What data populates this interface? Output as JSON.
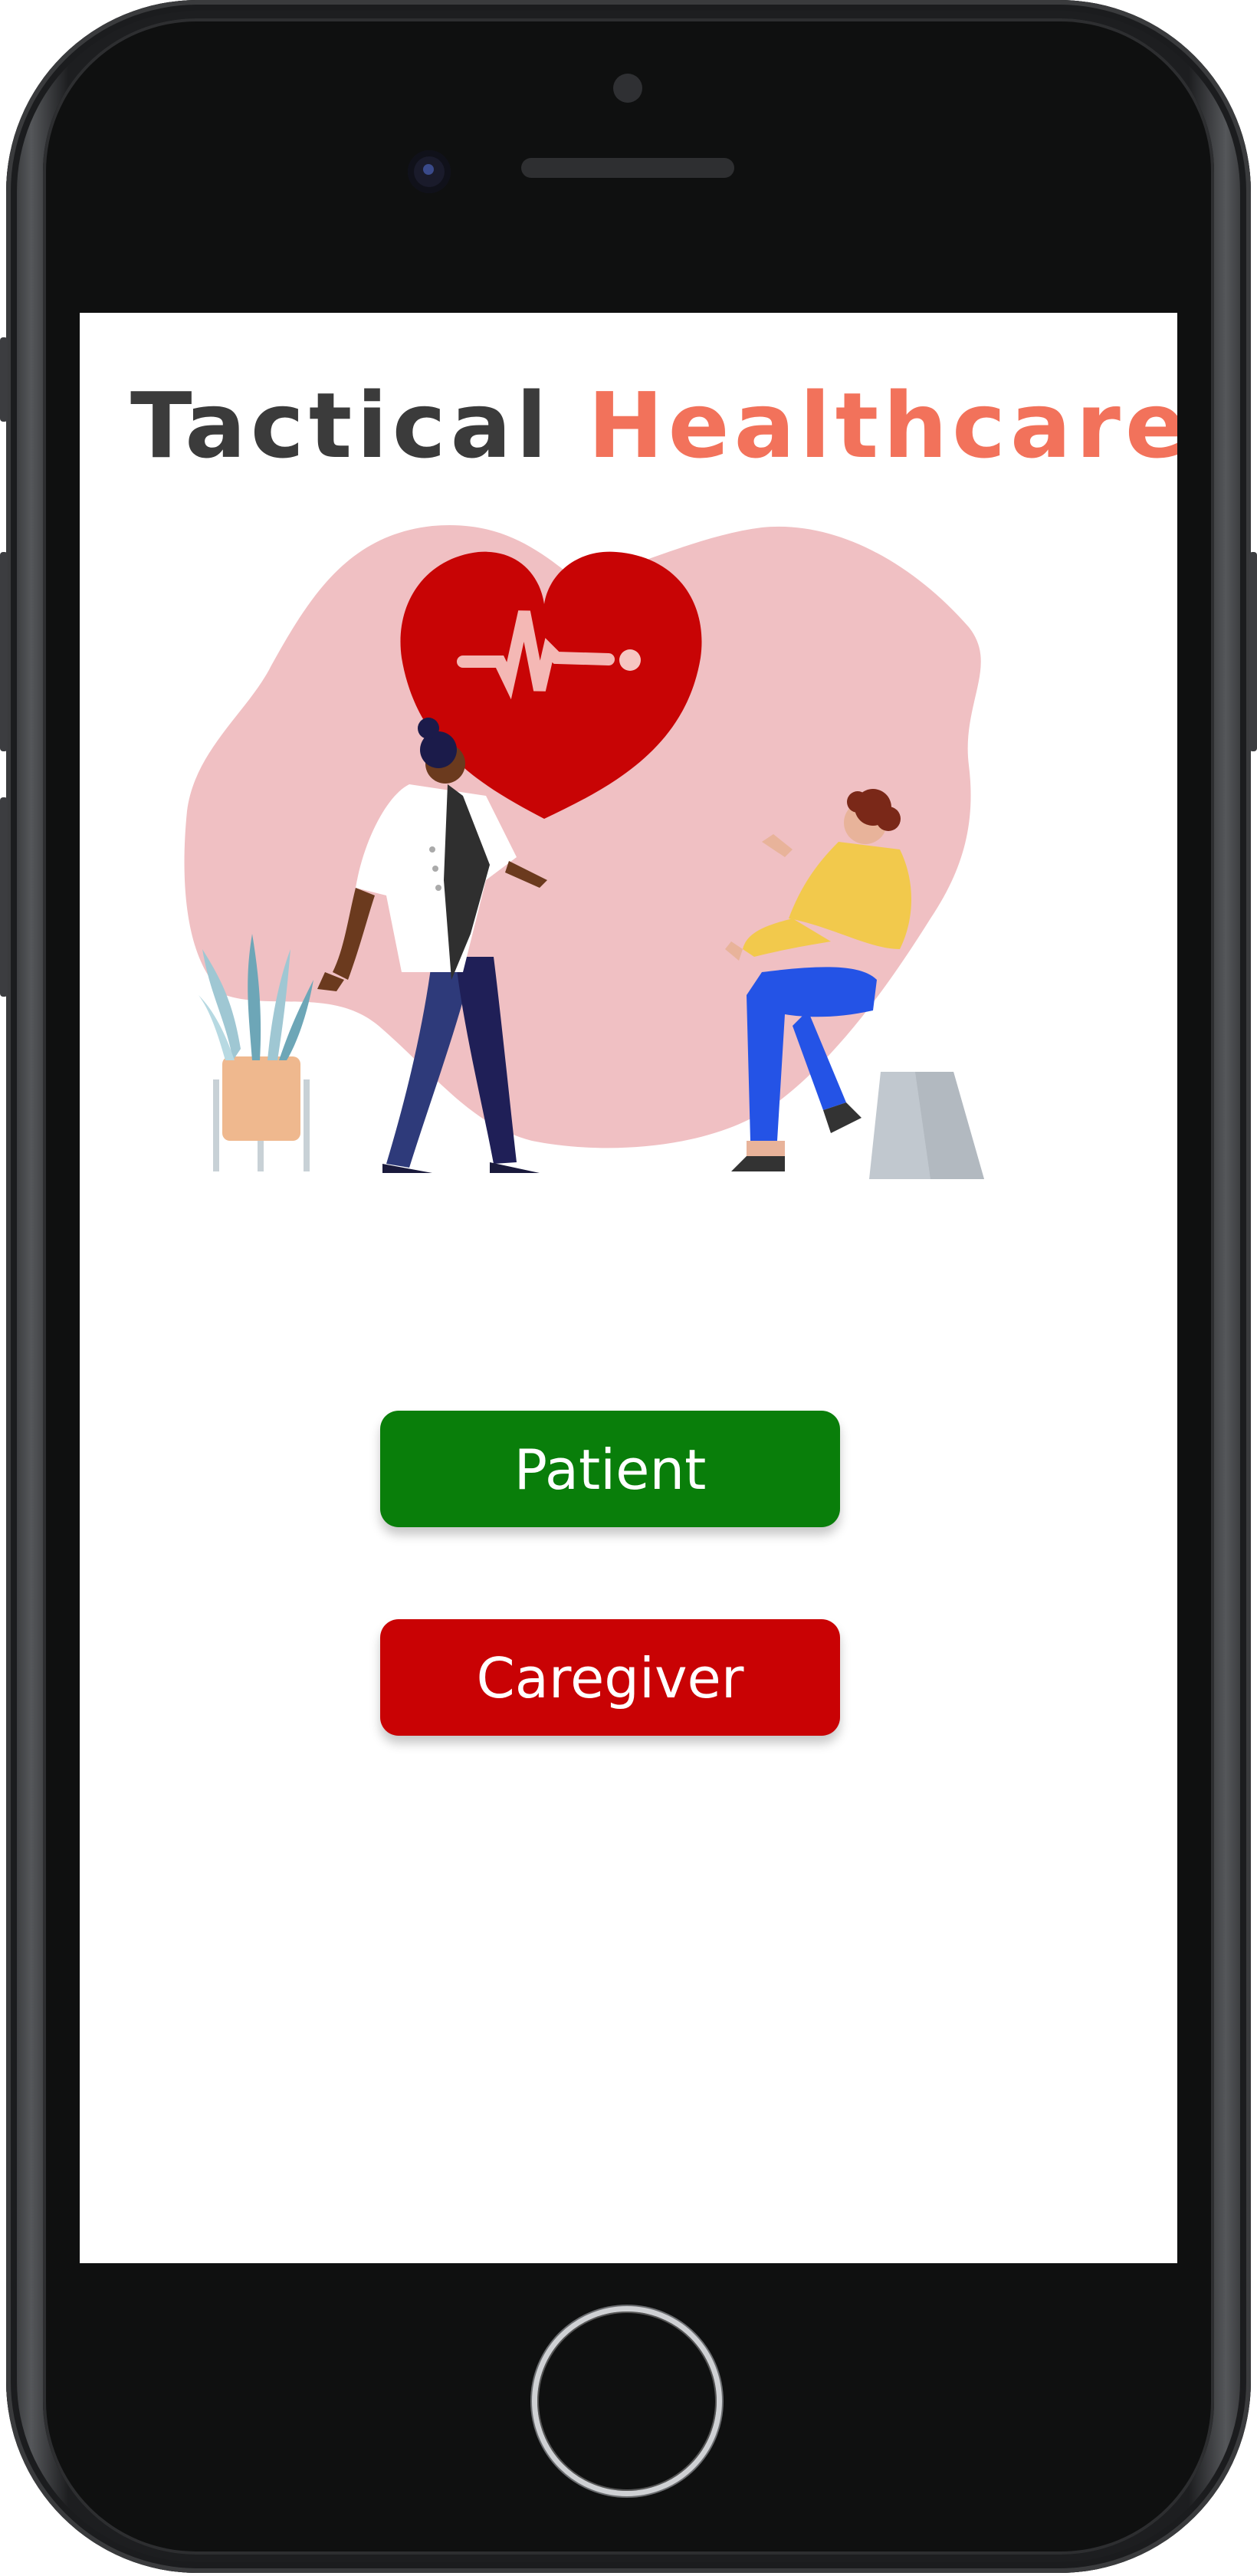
{
  "app": {
    "title_part1": "Tactical",
    "title_part2": "Healthcare"
  },
  "actions": {
    "patient_label": "Patient",
    "caregiver_label": "Caregiver"
  },
  "colors": {
    "title_dark": "#3b3b3b",
    "title_accent": "#f2725b",
    "patient_button": "#097e0a",
    "caregiver_button": "#c90204",
    "heart": "#c80405",
    "blob": "#f0c0c3"
  },
  "illustration": {
    "icon": "heartbeat-heart-icon",
    "scene": "doctor-patient-consultation"
  }
}
